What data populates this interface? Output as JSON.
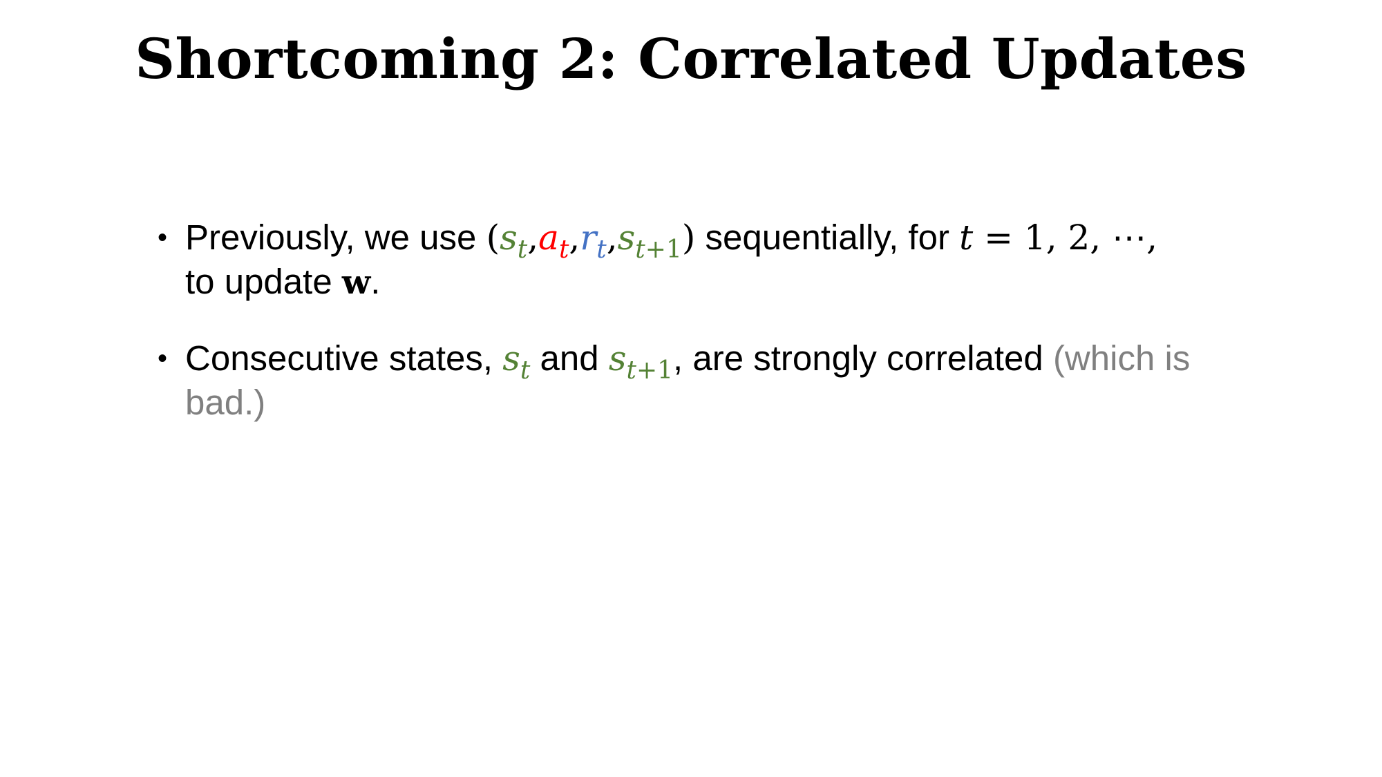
{
  "title": "Shortcoming 2: Correlated Updates",
  "colors": {
    "state": "#548235",
    "action": "#ff0000",
    "reward": "#4472c4",
    "aside": "#808080"
  },
  "bullet_marker": "•",
  "bullets": [
    {
      "text_prefix": "Previously, we use ",
      "tuple_open": "(",
      "s": "s",
      "s_sub": "t",
      "comma": ",",
      "a": "a",
      "a_sub": "t",
      "r": "r",
      "r_sub": "t",
      "s_next": "s",
      "s_next_sub_var": "t",
      "s_next_sub_rest": "+1",
      "tuple_close": ")",
      "text_middle": " sequentially, for ",
      "t_var": "t",
      "equals_seq": " = 1, 2, ⋯,",
      "line2_prefix": "to update ",
      "w": "w",
      "line2_suffix": "."
    },
    {
      "text_prefix": "Consecutive states, ",
      "s": "s",
      "s_sub": "t",
      "text_and": " and ",
      "s_next": "s",
      "s_next_sub_var": "t",
      "s_next_sub_rest": "+1",
      "text_middle": ", are strongly correlated ",
      "aside": "(which is bad.)"
    }
  ]
}
